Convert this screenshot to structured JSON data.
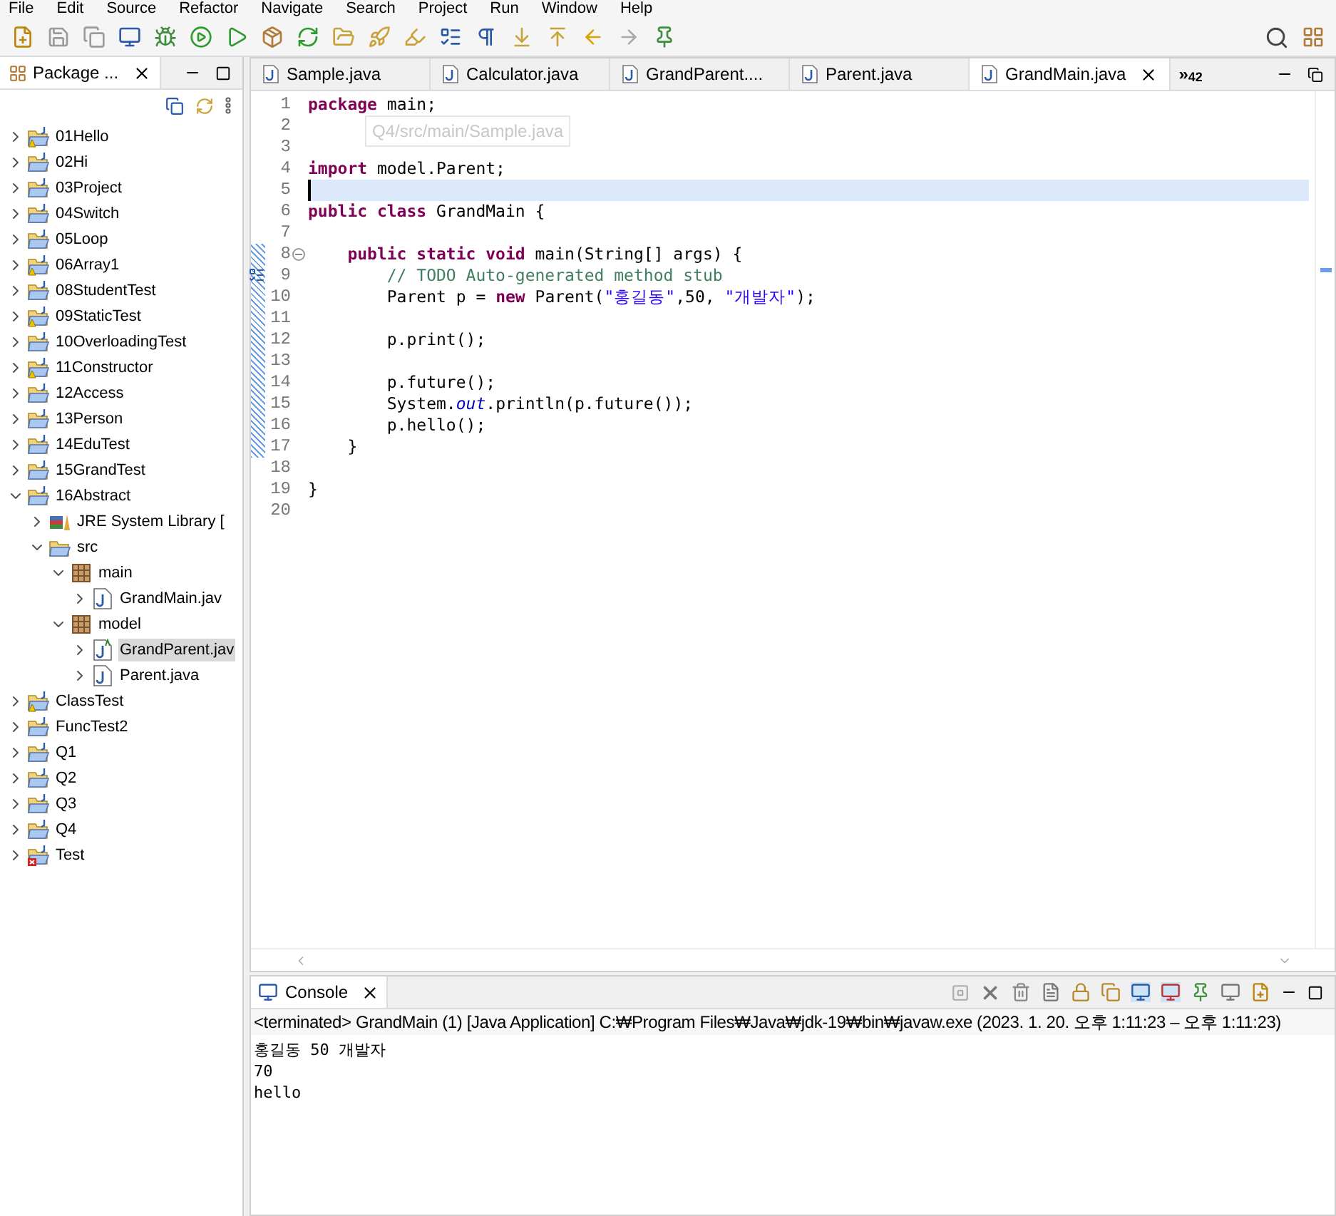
{
  "menu": [
    "File",
    "Edit",
    "Source",
    "Refactor",
    "Navigate",
    "Search",
    "Project",
    "Run",
    "Window",
    "Help"
  ],
  "package_explorer": {
    "title": "Package ...",
    "tree": [
      {
        "label": "01Hello",
        "kind": "project",
        "warning": true,
        "error": false,
        "expanded": false,
        "selected": false
      },
      {
        "label": "02Hi",
        "kind": "project",
        "warning": false,
        "error": false,
        "expanded": false,
        "selected": false
      },
      {
        "label": "03Project",
        "kind": "project",
        "warning": false,
        "error": false,
        "expanded": false,
        "selected": false
      },
      {
        "label": "04Switch",
        "kind": "project",
        "warning": false,
        "error": false,
        "expanded": false,
        "selected": false
      },
      {
        "label": "05Loop",
        "kind": "project",
        "warning": false,
        "error": false,
        "expanded": false,
        "selected": false
      },
      {
        "label": "06Array1",
        "kind": "project",
        "warning": true,
        "error": false,
        "expanded": false,
        "selected": false
      },
      {
        "label": "08StudentTest",
        "kind": "project",
        "warning": false,
        "error": false,
        "expanded": false,
        "selected": false
      },
      {
        "label": "09StaticTest",
        "kind": "project",
        "warning": true,
        "error": false,
        "expanded": false,
        "selected": false
      },
      {
        "label": "10OverloadingTest",
        "kind": "project",
        "warning": false,
        "error": false,
        "expanded": false,
        "selected": false
      },
      {
        "label": "11Constructor",
        "kind": "project",
        "warning": true,
        "error": false,
        "expanded": false,
        "selected": false
      },
      {
        "label": "12Access",
        "kind": "project",
        "warning": false,
        "error": false,
        "expanded": false,
        "selected": false
      },
      {
        "label": "13Person",
        "kind": "project",
        "warning": false,
        "error": false,
        "expanded": false,
        "selected": false
      },
      {
        "label": "14EduTest",
        "kind": "project",
        "warning": false,
        "error": false,
        "expanded": false,
        "selected": false
      },
      {
        "label": "15GrandTest",
        "kind": "project",
        "warning": false,
        "error": false,
        "expanded": false,
        "selected": false
      },
      {
        "label": "16Abstract",
        "kind": "project",
        "warning": false,
        "error": false,
        "expanded": true,
        "selected": false,
        "children": [
          {
            "label": "JRE System Library [",
            "kind": "library",
            "warning": false,
            "error": false,
            "expanded": false,
            "selected": false
          },
          {
            "label": "src",
            "kind": "folder",
            "warning": false,
            "error": false,
            "expanded": true,
            "selected": false,
            "children": [
              {
                "label": "main",
                "kind": "package",
                "warning": false,
                "error": false,
                "expanded": true,
                "selected": false,
                "children": [
                  {
                    "label": "GrandMain.jav",
                    "kind": "java",
                    "warning": false,
                    "error": false,
                    "expanded": false,
                    "selected": false
                  }
                ]
              },
              {
                "label": "model",
                "kind": "package",
                "warning": false,
                "error": false,
                "expanded": true,
                "selected": false,
                "children": [
                  {
                    "label": "GrandParent.jav",
                    "kind": "abstract",
                    "warning": false,
                    "error": false,
                    "expanded": false,
                    "selected": true
                  },
                  {
                    "label": "Parent.java",
                    "kind": "java",
                    "warning": false,
                    "error": false,
                    "expanded": false,
                    "selected": false
                  }
                ]
              }
            ]
          }
        ]
      },
      {
        "label": "ClassTest",
        "kind": "project",
        "warning": true,
        "error": false,
        "expanded": false,
        "selected": false
      },
      {
        "label": "FuncTest2",
        "kind": "project",
        "warning": false,
        "error": false,
        "expanded": false,
        "selected": false
      },
      {
        "label": "Q1",
        "kind": "project",
        "warning": false,
        "error": false,
        "expanded": false,
        "selected": false
      },
      {
        "label": "Q2",
        "kind": "project",
        "warning": false,
        "error": false,
        "expanded": false,
        "selected": false
      },
      {
        "label": "Q3",
        "kind": "project",
        "warning": false,
        "error": false,
        "expanded": false,
        "selected": false
      },
      {
        "label": "Q4",
        "kind": "project",
        "warning": false,
        "error": false,
        "expanded": false,
        "selected": false
      },
      {
        "label": "Test",
        "kind": "project",
        "warning": false,
        "error": true,
        "expanded": false,
        "selected": false
      }
    ]
  },
  "editor": {
    "tabs": [
      {
        "label": "Sample.java",
        "selected": false
      },
      {
        "label": "Calculator.java",
        "selected": false
      },
      {
        "label": "GrandParent....",
        "selected": false
      },
      {
        "label": "Parent.java",
        "selected": false
      },
      {
        "label": "GrandMain.java",
        "selected": true
      }
    ],
    "overflow": "»$_{42}$",
    "tooltip": "Q4/src/main/Sample.java",
    "lines": [
      {
        "number": "1",
        "kind": "code",
        "current": false,
        "tokens": [
          {
            "kind": "keyword",
            "text": "package"
          },
          {
            "kind": "plain",
            "text": " main;"
          }
        ]
      },
      {
        "number": "2",
        "kind": "code",
        "current": false
      },
      {
        "number": "3",
        "kind": "code",
        "current": false
      },
      {
        "number": "4",
        "kind": "code",
        "current": false,
        "tokens": [
          {
            "kind": "keyword",
            "text": "import"
          },
          {
            "kind": "plain",
            "text": " model.Parent;"
          }
        ]
      },
      {
        "number": "5",
        "kind": "code",
        "current": true
      },
      {
        "number": "6",
        "kind": "code",
        "current": false,
        "tokens": [
          {
            "kind": "keyword",
            "text": "public class"
          },
          {
            "kind": "plain",
            "text": " GrandMain {"
          }
        ]
      },
      {
        "number": "7",
        "kind": "code",
        "current": false
      },
      {
        "number": "8",
        "kind": "fold",
        "current": false,
        "tokens": [
          {
            "kind": "keyword",
            "text": "    public static void"
          },
          {
            "kind": "plain",
            "text": " main(String[] args) {"
          }
        ]
      },
      {
        "number": "9",
        "kind": "task",
        "current": false,
        "tokens": [
          {
            "kind": "comment",
            "text": "        // TODO Auto-generated method stub"
          }
        ]
      },
      {
        "number": "10",
        "kind": "code",
        "current": false,
        "tokens": [
          {
            "kind": "plain",
            "text": "        Parent p = "
          },
          {
            "kind": "keyword",
            "text": "new"
          },
          {
            "kind": "plain",
            "text": " Parent("
          },
          {
            "kind": "string",
            "text": "\"홍길동\""
          },
          {
            "kind": "plain",
            "text": ",50, "
          },
          {
            "kind": "string",
            "text": "\"개발자\""
          },
          {
            "kind": "plain",
            "text": ");"
          }
        ]
      },
      {
        "number": "11",
        "kind": "code",
        "current": false
      },
      {
        "number": "12",
        "kind": "code",
        "current": false,
        "tokens": [
          {
            "kind": "plain",
            "text": "        p.print();"
          }
        ]
      },
      {
        "number": "13",
        "kind": "code",
        "current": false
      },
      {
        "number": "14",
        "kind": "code",
        "current": false,
        "tokens": [
          {
            "kind": "plain",
            "text": "        p.future();"
          }
        ]
      },
      {
        "number": "15",
        "kind": "code",
        "current": false,
        "tokens": [
          {
            "kind": "plain",
            "text": "        System."
          },
          {
            "kind": "field",
            "text": "out"
          },
          {
            "kind": "plain",
            "text": ".println(p.future());"
          }
        ]
      },
      {
        "number": "16",
        "kind": "code",
        "current": false,
        "tokens": [
          {
            "kind": "plain",
            "text": "        p.hello();"
          }
        ]
      },
      {
        "number": "17",
        "kind": "code",
        "current": false,
        "tokens": [
          {
            "kind": "plain",
            "text": "    }"
          }
        ]
      },
      {
        "number": "18",
        "kind": "code",
        "current": false
      },
      {
        "number": "19",
        "kind": "code",
        "current": false,
        "tokens": [
          {
            "kind": "plain",
            "text": "}"
          }
        ]
      },
      {
        "number": "20",
        "kind": "code",
        "current": false
      }
    ]
  },
  "console": {
    "title": "Console",
    "status": "<terminated> GrandMain (1) [Java Application] C:₩Program Files₩Java₩jdk-19₩bin₩javaw.exe  (2023. 1. 20. 오후 1:11:23 – 오후 1:11:23)",
    "output": [
      "홍길동 50 개발자",
      "70",
      "hello"
    ]
  }
}
